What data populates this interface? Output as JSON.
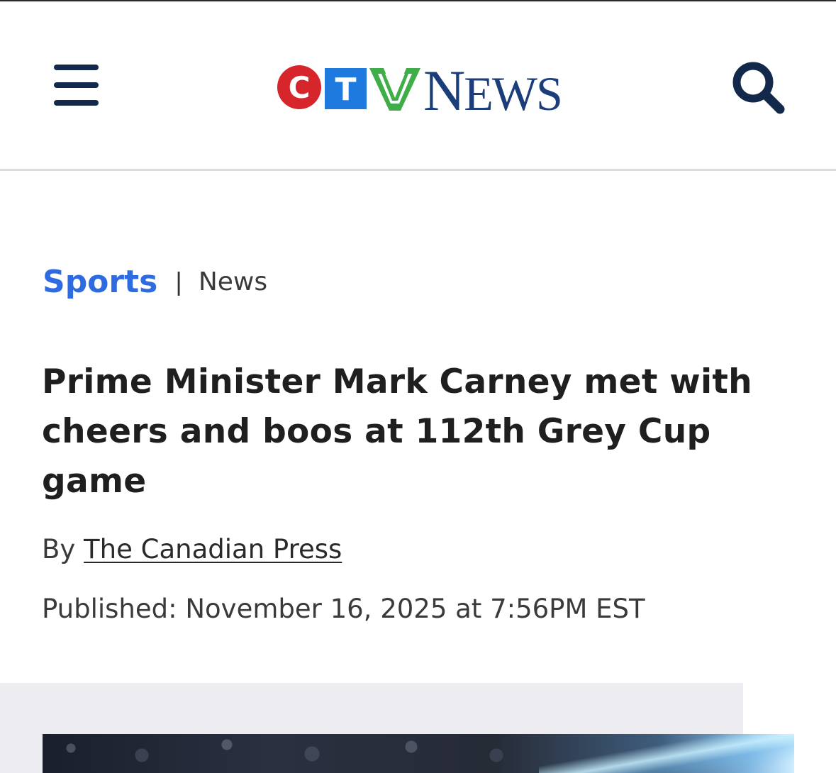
{
  "header": {
    "menu_icon": "hamburger-menu-icon",
    "logo": {
      "letters": [
        "C",
        "T",
        "V"
      ],
      "wordmark_initial": "N",
      "wordmark_rest": "EWS",
      "colors": {
        "c": "#d7262b",
        "t": "#1f7ae0",
        "v": "#3fae49",
        "news": "#1b3d7a"
      }
    },
    "search_icon": "search-icon"
  },
  "breadcrumb": {
    "section": "Sports",
    "separator": "|",
    "subsection": "News"
  },
  "article": {
    "headline": "Prime Minister Mark Carney met with cheers and boos at 112th Grey Cup game",
    "byline_prefix": "By",
    "author": "The Canadian Press",
    "published": "Published: November 16, 2025 at 7:56PM EST"
  },
  "colors": {
    "accent_link": "#2f6be0",
    "header_navy": "#13294b",
    "text": "#1f1f1f",
    "media_band": "#ededf1"
  }
}
